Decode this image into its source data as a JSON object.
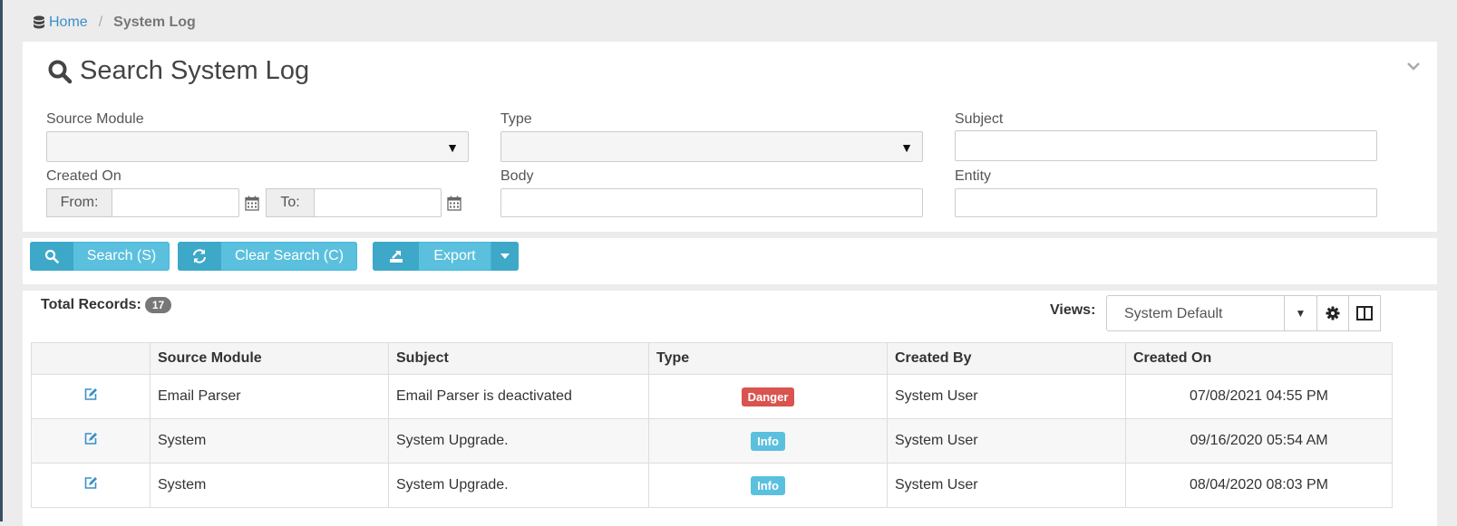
{
  "breadcrumb": {
    "home": "Home",
    "separator": "/",
    "current": "System Log"
  },
  "search_panel": {
    "title": "Search System Log",
    "fields": {
      "source_module": {
        "label": "Source Module",
        "value": ""
      },
      "type": {
        "label": "Type",
        "value": ""
      },
      "subject": {
        "label": "Subject",
        "value": ""
      },
      "created_on": {
        "label": "Created On",
        "from_label": "From:",
        "from_value": "",
        "to_label": "To:",
        "to_value": ""
      },
      "body": {
        "label": "Body",
        "value": ""
      },
      "entity": {
        "label": "Entity",
        "value": ""
      }
    }
  },
  "actions": {
    "search": "Search (S)",
    "clear": "Clear Search (C)",
    "export": "Export"
  },
  "results": {
    "total_label": "Total Records:",
    "total_count": "17",
    "views_label": "Views:",
    "views_value": "System Default",
    "columns": [
      "",
      "Source Module",
      "Subject",
      "Type",
      "Created By",
      "Created On"
    ],
    "rows": [
      {
        "source_module": "Email Parser",
        "subject": "Email Parser is deactivated",
        "type": "Danger",
        "type_style": "danger",
        "created_by": "System User",
        "created_on": "07/08/2021 04:55 PM"
      },
      {
        "source_module": "System",
        "subject": "System Upgrade.",
        "type": "Info",
        "type_style": "info",
        "created_by": "System User",
        "created_on": "09/16/2020 05:54 AM"
      },
      {
        "source_module": "System",
        "subject": "System Upgrade.",
        "type": "Info",
        "type_style": "info",
        "created_by": "System User",
        "created_on": "08/04/2020 08:03 PM"
      }
    ]
  },
  "colors": {
    "accent": "#5bc0de",
    "link": "#3a8fc8",
    "danger": "#d9534f",
    "badge": "#777777"
  },
  "icons": [
    "database-icon",
    "search-icon",
    "chevron-down-icon",
    "calendar-icon",
    "refresh-icon",
    "export-icon",
    "caret-down-icon",
    "gear-icon",
    "columns-icon",
    "edit-icon"
  ]
}
